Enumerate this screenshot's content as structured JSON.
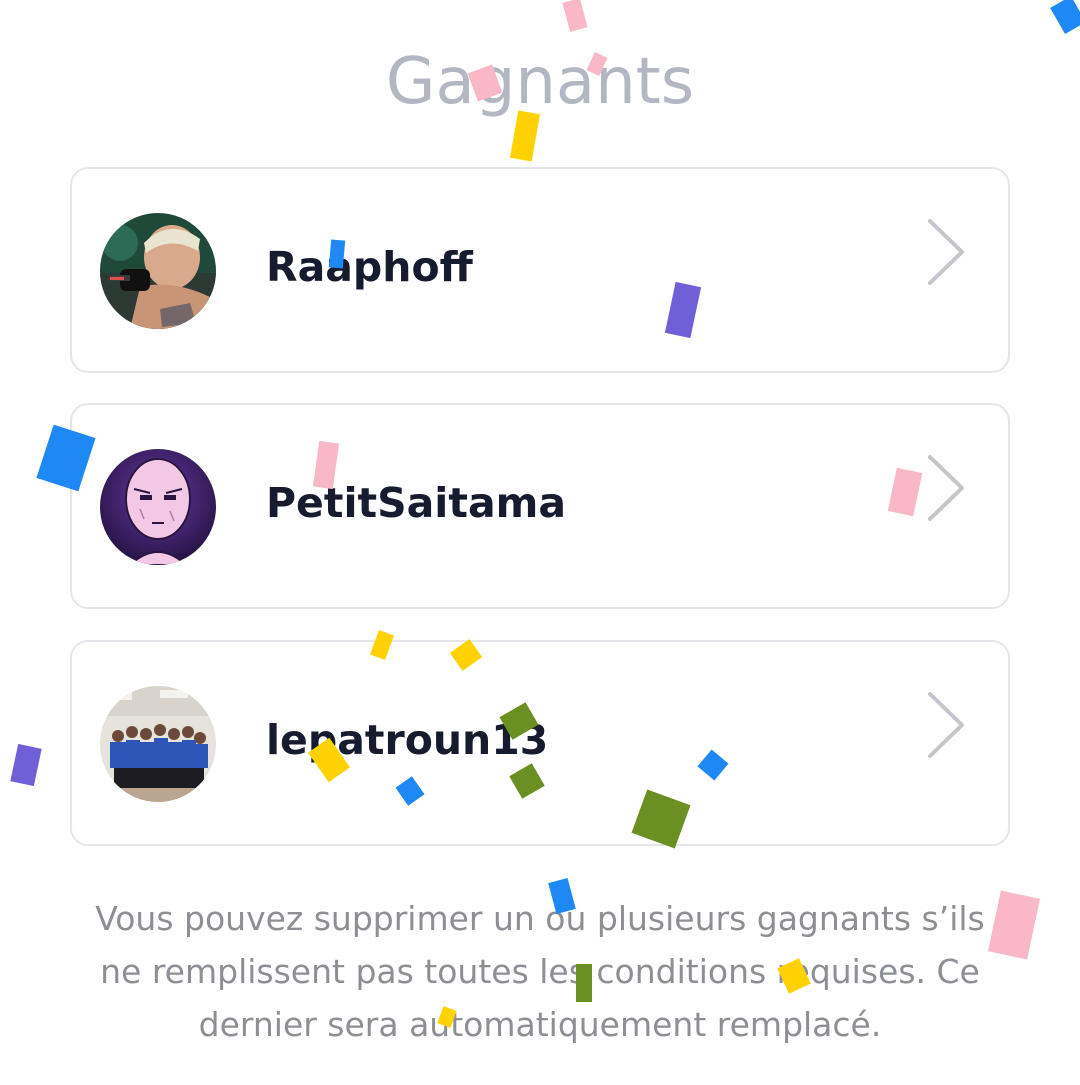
{
  "page": {
    "title": "Gagnants",
    "footnote": "Vous pouvez supprimer un ou plusieurs gagnants s’ils ne remplissent pas toutes les conditions requises. Ce dernier sera automatiquement remplacé."
  },
  "winners": [
    {
      "name": "Raaphoff",
      "avatar": "user-avatar-photo",
      "action_icon": "chevron-right-icon"
    },
    {
      "name": "PetitSaitama",
      "avatar": "user-avatar-illustration",
      "action_icon": "chevron-right-icon"
    },
    {
      "name": "lepatroun13",
      "avatar": "user-avatar-group-photo",
      "action_icon": "chevron-right-icon"
    }
  ],
  "theme": {
    "background": "#ffffff",
    "title_color": "#b3b7c2",
    "name_color": "#161b2e",
    "footnote_color": "#8d8f94",
    "card_border": "#e4e6ea",
    "chevron_color": "#c4c6cb"
  },
  "confetti": {
    "colors": {
      "pink": "#f9b8c8",
      "blue": "#1e88f5",
      "yellow": "#ffd200",
      "green": "#6a8f22",
      "purple": "#7060d8"
    }
  }
}
